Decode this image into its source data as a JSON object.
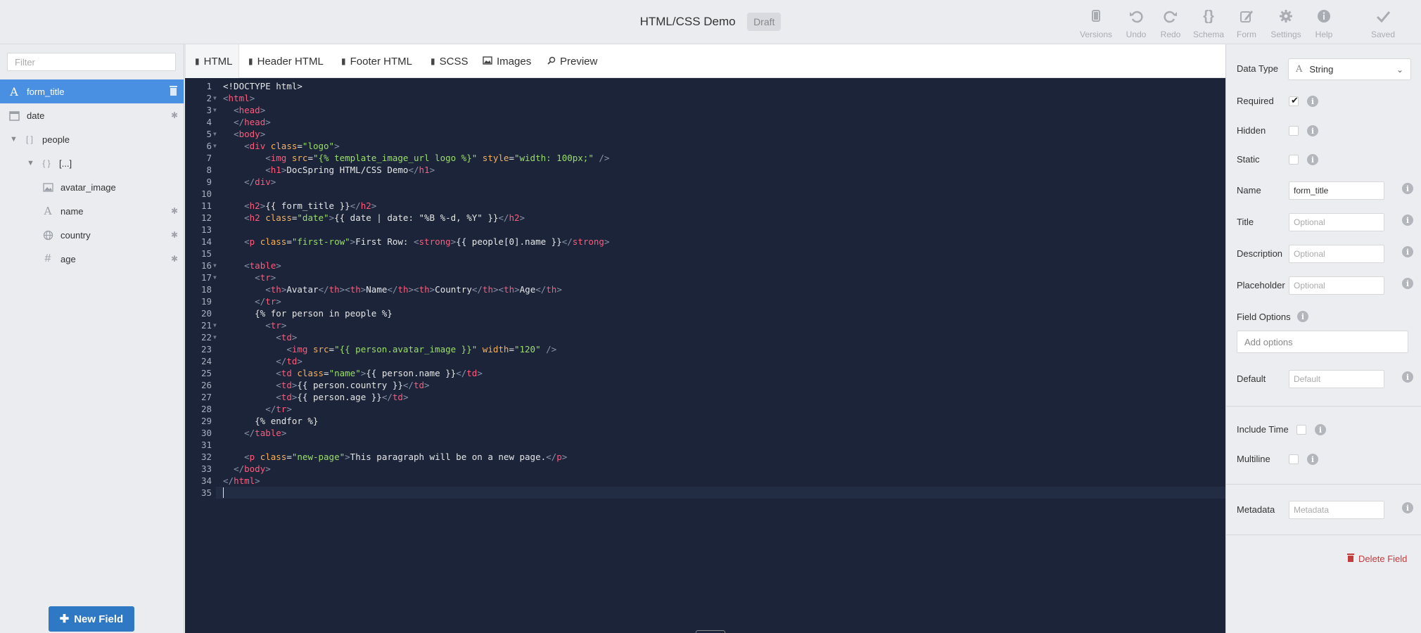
{
  "header": {
    "title": "HTML/CSS Demo",
    "badge": "Draft",
    "toolbar": [
      {
        "label": "Versions",
        "icon": "versions-icon"
      },
      {
        "label": "Undo",
        "icon": "undo-icon"
      },
      {
        "label": "Redo",
        "icon": "redo-icon"
      },
      {
        "label": "Schema",
        "icon": "schema-icon"
      },
      {
        "label": "Form",
        "icon": "form-icon"
      },
      {
        "label": "Settings",
        "icon": "settings-icon"
      },
      {
        "label": "Help",
        "icon": "help-icon"
      },
      {
        "label": "Saved",
        "icon": "check-icon"
      }
    ]
  },
  "sidebar": {
    "filter_placeholder": "Filter",
    "fields": [
      {
        "name": "form_title",
        "icon": "text-icon",
        "selected": true,
        "action": "trash-icon"
      },
      {
        "name": "date",
        "icon": "calendar-icon",
        "required": true
      },
      {
        "name": "people",
        "icon": "array-icon",
        "expanded": true
      },
      {
        "name": "[...]",
        "icon": "object-icon",
        "expanded": true
      },
      {
        "name": "avatar_image",
        "icon": "image-icon"
      },
      {
        "name": "name",
        "icon": "text-icon",
        "required": true
      },
      {
        "name": "country",
        "icon": "globe-icon",
        "required": true
      },
      {
        "name": "age",
        "icon": "number-icon",
        "required": true
      }
    ],
    "new_field_label": "New Field"
  },
  "tabs": [
    {
      "label": "HTML",
      "icon": "file-icon",
      "active": true
    },
    {
      "label": "Header HTML",
      "icon": "file-icon"
    },
    {
      "label": "Footer HTML",
      "icon": "file-icon"
    },
    {
      "label": "SCSS",
      "icon": "file-icon"
    },
    {
      "label": "Images",
      "icon": "image-icon"
    },
    {
      "label": "Preview",
      "icon": "search-icon"
    }
  ],
  "editor": {
    "line_count": 35,
    "active_line": 35,
    "lines": [
      "<!DOCTYPE html>",
      "<html>",
      "  <head>",
      "  </head>",
      "  <body>",
      "    <div class=\"logo\">",
      "        <img src=\"{% template_image_url logo %}\" style=\"width: 100px;\" />",
      "        <h1>DocSpring HTML/CSS Demo</h1>",
      "    </div>",
      "",
      "    <h2>{{ form_title }}</h2>",
      "    <h2 class=\"date\">{{ date | date: \"%B %-d, %Y\" }}</h2>",
      "",
      "    <p class=\"first-row\">First Row: <strong>{{ people[0].name }}</strong>",
      "",
      "    <table>",
      "      <tr>",
      "        <th>Avatar</th><th>Name</th><th>Country</th><th>Age</th>",
      "      </tr>",
      "      {% for person in people %}",
      "        <tr>",
      "          <td>",
      "            <img src=\"{{ person.avatar_image }}\" width=\"120\" />",
      "          </td>",
      "          <td class=\"name\">{{ person.name }}</td>",
      "          <td>{{ person.country }}</td>",
      "          <td>{{ person.age }}</td>",
      "        </tr>",
      "      {% endfor %}",
      "    </table>",
      "",
      "    <p class=\"new-page\">This paragraph will be on a new page.</p>",
      "  </body>",
      "</html>",
      ""
    ],
    "folds": [
      2,
      3,
      5,
      6,
      16,
      17,
      21,
      22
    ]
  },
  "properties": {
    "data_type": {
      "label": "Data Type",
      "value": "String"
    },
    "required": {
      "label": "Required",
      "checked": true
    },
    "hidden": {
      "label": "Hidden",
      "checked": false
    },
    "static": {
      "label": "Static",
      "checked": false
    },
    "name": {
      "label": "Name",
      "value": "form_title"
    },
    "title": {
      "label": "Title",
      "placeholder": "Optional"
    },
    "description": {
      "label": "Description",
      "placeholder": "Optional"
    },
    "placeholder": {
      "label": "Placeholder",
      "placeholder": "Optional"
    },
    "field_options": {
      "label": "Field Options",
      "placeholder": "Add options"
    },
    "default": {
      "label": "Default",
      "placeholder": "Default"
    },
    "include_time": {
      "label": "Include Time",
      "checked": false
    },
    "multiline": {
      "label": "Multiline",
      "checked": false
    },
    "metadata": {
      "label": "Metadata",
      "placeholder": "Metadata"
    },
    "delete_label": "Delete Field"
  },
  "colors": {
    "accent": "#4a90e2",
    "button": "#2f78c4",
    "editor_bg": "#1b2438",
    "tag": "#ff5b7b",
    "attr": "#f7b15e",
    "string": "#9bde6c",
    "danger": "#c43b3b"
  }
}
